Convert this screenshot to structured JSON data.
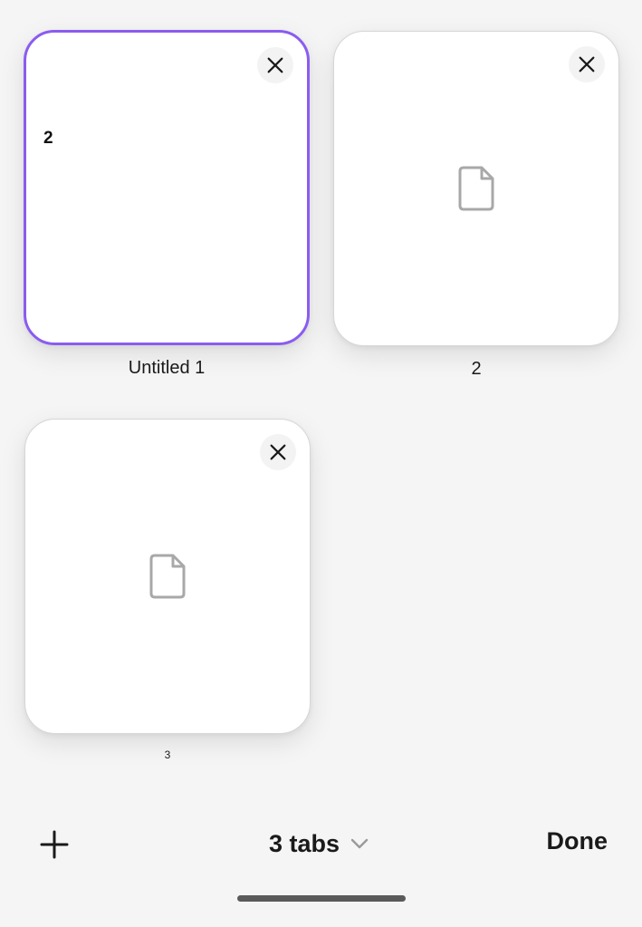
{
  "tabs": [
    {
      "title": "Untitled 1",
      "preview_text": "2",
      "active": true
    },
    {
      "title": "2",
      "active": false
    },
    {
      "title": "3",
      "active": false
    }
  ],
  "bottom_bar": {
    "tabs_count_label": "3 tabs",
    "done_label": "Done"
  },
  "icons": {
    "close": "close-icon",
    "document": "document-icon",
    "add": "plus-icon",
    "chevron": "chevron-down-icon"
  },
  "colors": {
    "active_border": "#8a5cf0",
    "background": "#f5f5f5",
    "card": "#ffffff",
    "icon_gray": "#a8a8a8"
  }
}
